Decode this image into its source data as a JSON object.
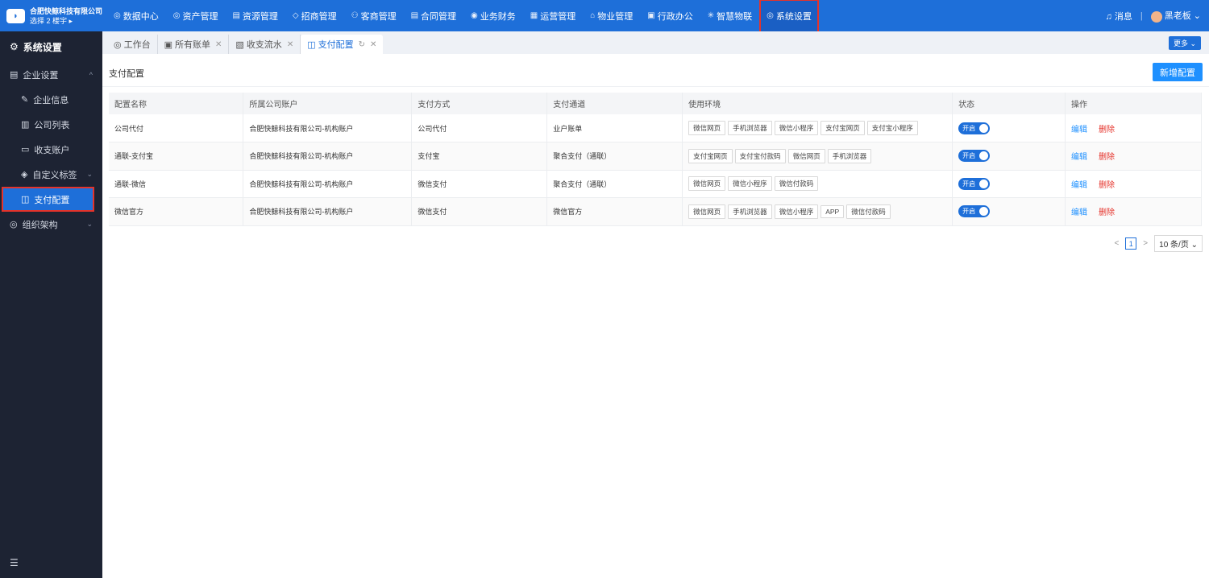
{
  "header": {
    "company": "合肥快鲸科技有限公司",
    "sub": "选择 2 楼宇 ▸",
    "nav": [
      {
        "icon": "◎",
        "label": "数据中心"
      },
      {
        "icon": "◎",
        "label": "资产管理"
      },
      {
        "icon": "▤",
        "label": "资源管理"
      },
      {
        "icon": "◇",
        "label": "招商管理"
      },
      {
        "icon": "⚇",
        "label": "客商管理"
      },
      {
        "icon": "▤",
        "label": "合同管理"
      },
      {
        "icon": "◉",
        "label": "业务财务"
      },
      {
        "icon": "▦",
        "label": "运营管理"
      },
      {
        "icon": "⌂",
        "label": "物业管理"
      },
      {
        "icon": "▣",
        "label": "行政办公"
      },
      {
        "icon": "✳",
        "label": "智慧物联"
      },
      {
        "icon": "◎",
        "label": "系统设置"
      }
    ],
    "messages": "消息",
    "user": "黑老板"
  },
  "sidebar": {
    "title": "系统设置",
    "group": "企业设置",
    "items": [
      "企业信息",
      "公司列表",
      "收支账户",
      "自定义标签",
      "支付配置"
    ],
    "group2": "组织架构"
  },
  "tabs": [
    "工作台",
    "所有账单",
    "收支流水",
    "支付配置"
  ],
  "more": "更多",
  "page": {
    "title": "支付配置",
    "add_button": "新增配置"
  },
  "table": {
    "headers": [
      "配置名称",
      "所属公司账户",
      "支付方式",
      "支付通道",
      "使用环境",
      "状态",
      "操作"
    ],
    "rows": [
      {
        "name": "公司代付",
        "account": "合肥快鲸科技有限公司-机构账户",
        "method": "公司代付",
        "channel": "业户账单",
        "envs": [
          "微信网页",
          "手机浏览器",
          "微信小程序",
          "支付宝网页",
          "支付宝小程序"
        ],
        "status": "开启"
      },
      {
        "name": "通联-支付宝",
        "account": "合肥快鲸科技有限公司-机构账户",
        "method": "支付宝",
        "channel": "聚合支付（通联）",
        "envs": [
          "支付宝网页",
          "支付宝付款码",
          "微信网页",
          "手机浏览器"
        ],
        "status": "开启"
      },
      {
        "name": "通联-微信",
        "account": "合肥快鲸科技有限公司-机构账户",
        "method": "微信支付",
        "channel": "聚合支付（通联）",
        "envs": [
          "微信网页",
          "微信小程序",
          "微信付款码"
        ],
        "status": "开启"
      },
      {
        "name": "微信官方",
        "account": "合肥快鲸科技有限公司-机构账户",
        "method": "微信支付",
        "channel": "微信官方",
        "envs": [
          "微信网页",
          "手机浏览器",
          "微信小程序",
          "APP",
          "微信付款码"
        ],
        "status": "开启"
      }
    ],
    "edit": "编辑",
    "delete": "删除"
  },
  "pager": {
    "current": "1",
    "size": "10 条/页"
  }
}
